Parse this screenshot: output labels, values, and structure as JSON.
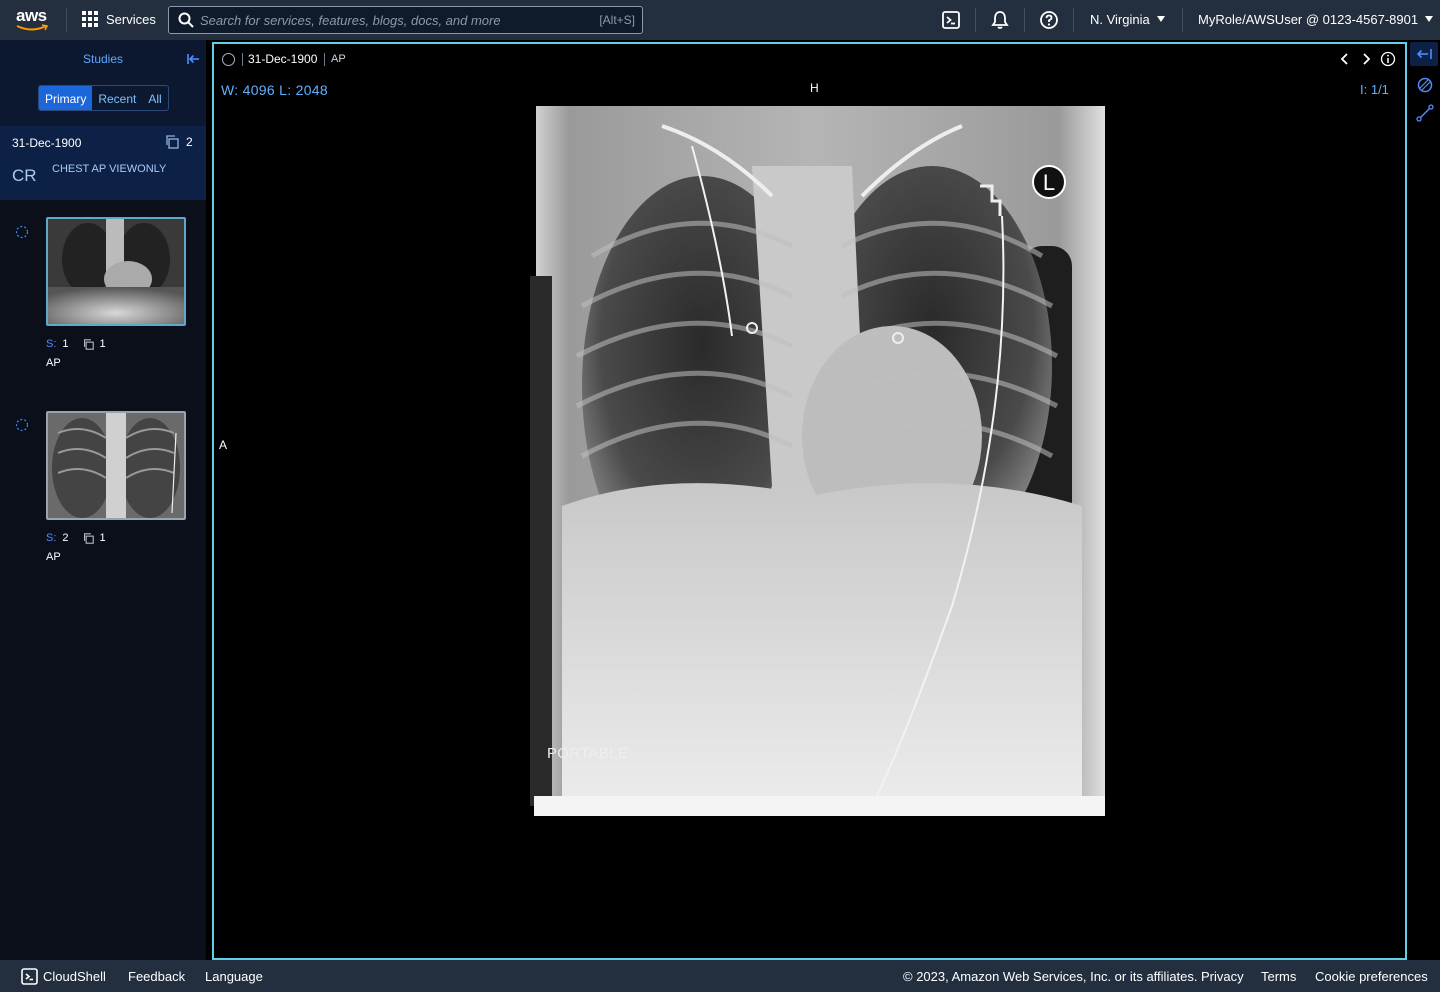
{
  "topnav": {
    "logo_text": "aws",
    "services_label": "Services",
    "search_placeholder": "Search for services, features, blogs, docs, and more",
    "search_shortcut": "[Alt+S]",
    "region_label": "N. Virginia",
    "account_label": "MyRole/AWSUser @ 0123-4567-8901",
    "icons": [
      "cloudshell-icon",
      "bell-icon",
      "help-icon"
    ]
  },
  "sidebar": {
    "title": "Studies",
    "tabs": [
      {
        "label": "Primary",
        "active": true
      },
      {
        "label": "Recent",
        "active": false
      },
      {
        "label": "All",
        "active": false
      }
    ],
    "study": {
      "date": "31-Dec-1900",
      "count": "2",
      "modality": "CR",
      "description": "CHEST AP VIEWONLY"
    },
    "series": [
      {
        "series_label": "S:",
        "series_number": "1",
        "image_count": "1",
        "name": "AP",
        "selected": true
      },
      {
        "series_label": "S:",
        "series_number": "2",
        "image_count": "1",
        "name": "AP",
        "selected": false
      }
    ]
  },
  "viewer": {
    "date": "31-Dec-1900",
    "view": "AP",
    "window_level": "W: 4096 L: 2048",
    "orientation_top": "H",
    "orientation_left": "A",
    "image_counter": "I: 1/1",
    "marker_letter": "L",
    "burned_text": "PORTABLE"
  },
  "footer": {
    "cloudshell": "CloudShell",
    "feedback": "Feedback",
    "language": "Language",
    "copyright": "© 2023, Amazon Web Services, Inc. or its affiliates.",
    "privacy": "Privacy",
    "terms": "Terms",
    "cookies": "Cookie preferences"
  },
  "colors": {
    "nav_bg": "#232f3e",
    "accent": "#5fd0e8",
    "link_blue": "#5fa8ff",
    "active_tab": "#1b66d8"
  }
}
